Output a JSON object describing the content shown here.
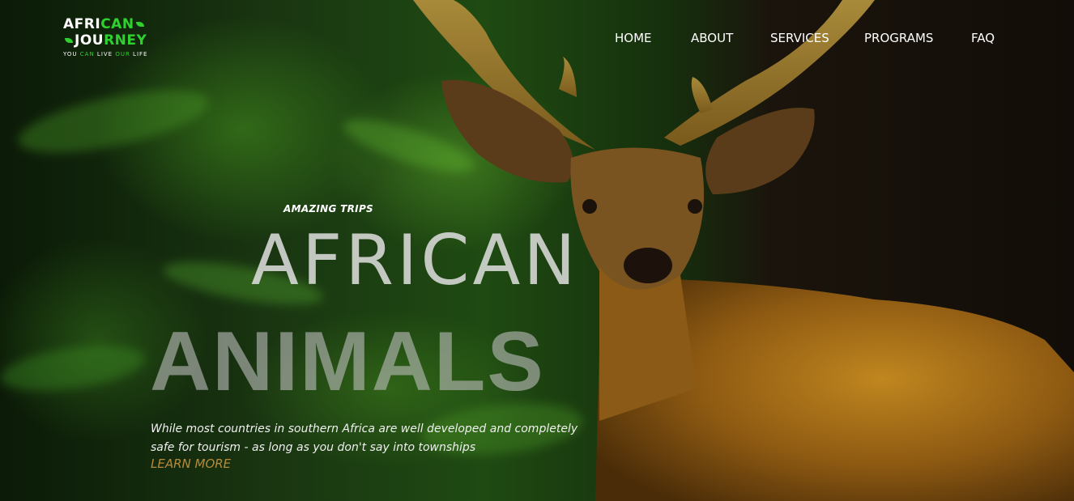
{
  "brand": {
    "line1_a": "AFRI",
    "line1_b": "CAN",
    "line2_a": "JOU",
    "line2_b": "RNEY",
    "tagline_a": "YOU ",
    "tagline_b": "CAN",
    "tagline_c": " LIVE ",
    "tagline_d": "OUR",
    "tagline_e": " LIFE",
    "accent": "#2fd12f"
  },
  "nav": {
    "items": [
      {
        "label": "HOME"
      },
      {
        "label": "ABOUT"
      },
      {
        "label": "SERVICES"
      },
      {
        "label": "PROGRAMS"
      },
      {
        "label": "FAQ"
      }
    ]
  },
  "hero": {
    "eyebrow": "AMAZING TRIPS",
    "title_line1": "AFRICAN",
    "title_line2": "ANIMALS",
    "description": "While most countries in southern Africa are well developed and completely safe for tourism - as long as you don't say into townships",
    "cta": "LEARN MORE",
    "cta_color": "#b78a3a"
  }
}
